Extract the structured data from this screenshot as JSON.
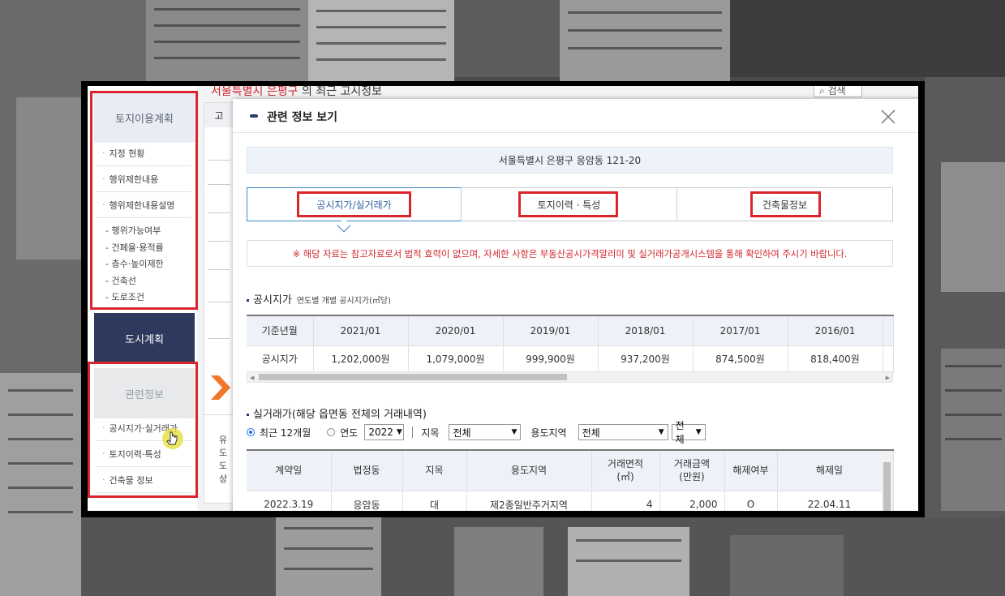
{
  "colors": {
    "highlight_red": "#d9252b",
    "nav_dark": "#2d3a5e",
    "accent_blue": "#3f86c6",
    "notice_red": "#d0262d"
  },
  "background_page": {
    "title_red": "서울특별시 은평구",
    "title_rest": "의 최근 고시정보",
    "search_label": "검색",
    "col_head": "고",
    "side_texts": [
      "유",
      "도",
      "도",
      "상"
    ]
  },
  "leftnav": {
    "land_plan": "토지이용계획",
    "items": [
      "지정 현황",
      "행위제한내용",
      "행위제한내용설명"
    ],
    "sub_items": [
      "- 행위가능여부",
      "- 건폐율·용적률",
      "- 층수·높이제한",
      "- 건축선",
      "- 도로조건"
    ],
    "city_plan": "도시계획",
    "related": "관련정보",
    "related_items": [
      "공시지가·실거래가",
      "토지이력·특성",
      "건축물 정보"
    ]
  },
  "modal": {
    "title": "관련 정보 보기",
    "address": "서울특별시 은평구 응암동 121-20",
    "tabs": [
      "공시지가/실거래가",
      "토지이력 · 특성",
      "건축물정보"
    ],
    "notice": "※ 해당 자료는 참고자료로서 법적 효력이 없으며, 자세한 사항은 부동산공시가격알리미 및 실거래가공개시스템을 통해 확인하여 주시기 바랍니다.",
    "price_section": {
      "title": "공시지가",
      "subtitle": "연도별 개별 공시지가(㎡당)"
    },
    "price_table": {
      "headers": [
        "기준년월",
        "2021/01",
        "2020/01",
        "2019/01",
        "2018/01",
        "2017/01",
        "2016/01"
      ],
      "row": [
        "공시지가",
        "1,202,000원",
        "1,079,000원",
        "999,900원",
        "937,200원",
        "874,500원",
        "818,400원"
      ]
    },
    "deal_section": {
      "title": "실거래가(해당 읍면동 전체의 거래내역)"
    },
    "filters": {
      "recent_label": "최근 12개월",
      "year_label": "연도",
      "year_value": "2022",
      "jimok_label": "지목",
      "jimok_value": "전체",
      "zone_label": "용도지역",
      "zone_value": "전체",
      "zone2_value": "전체"
    },
    "deal_table": {
      "headers": [
        "계약일",
        "법정동",
        "지목",
        "용도지역",
        "거래면적\n(㎡)",
        "거래금액\n(만원)",
        "해제여부",
        "해제일"
      ],
      "rows": [
        [
          "2022.3.19",
          "응암동",
          "대",
          "제2종일반주거지역",
          "4",
          "2,000",
          "O",
          "22.04.11"
        ]
      ]
    }
  }
}
